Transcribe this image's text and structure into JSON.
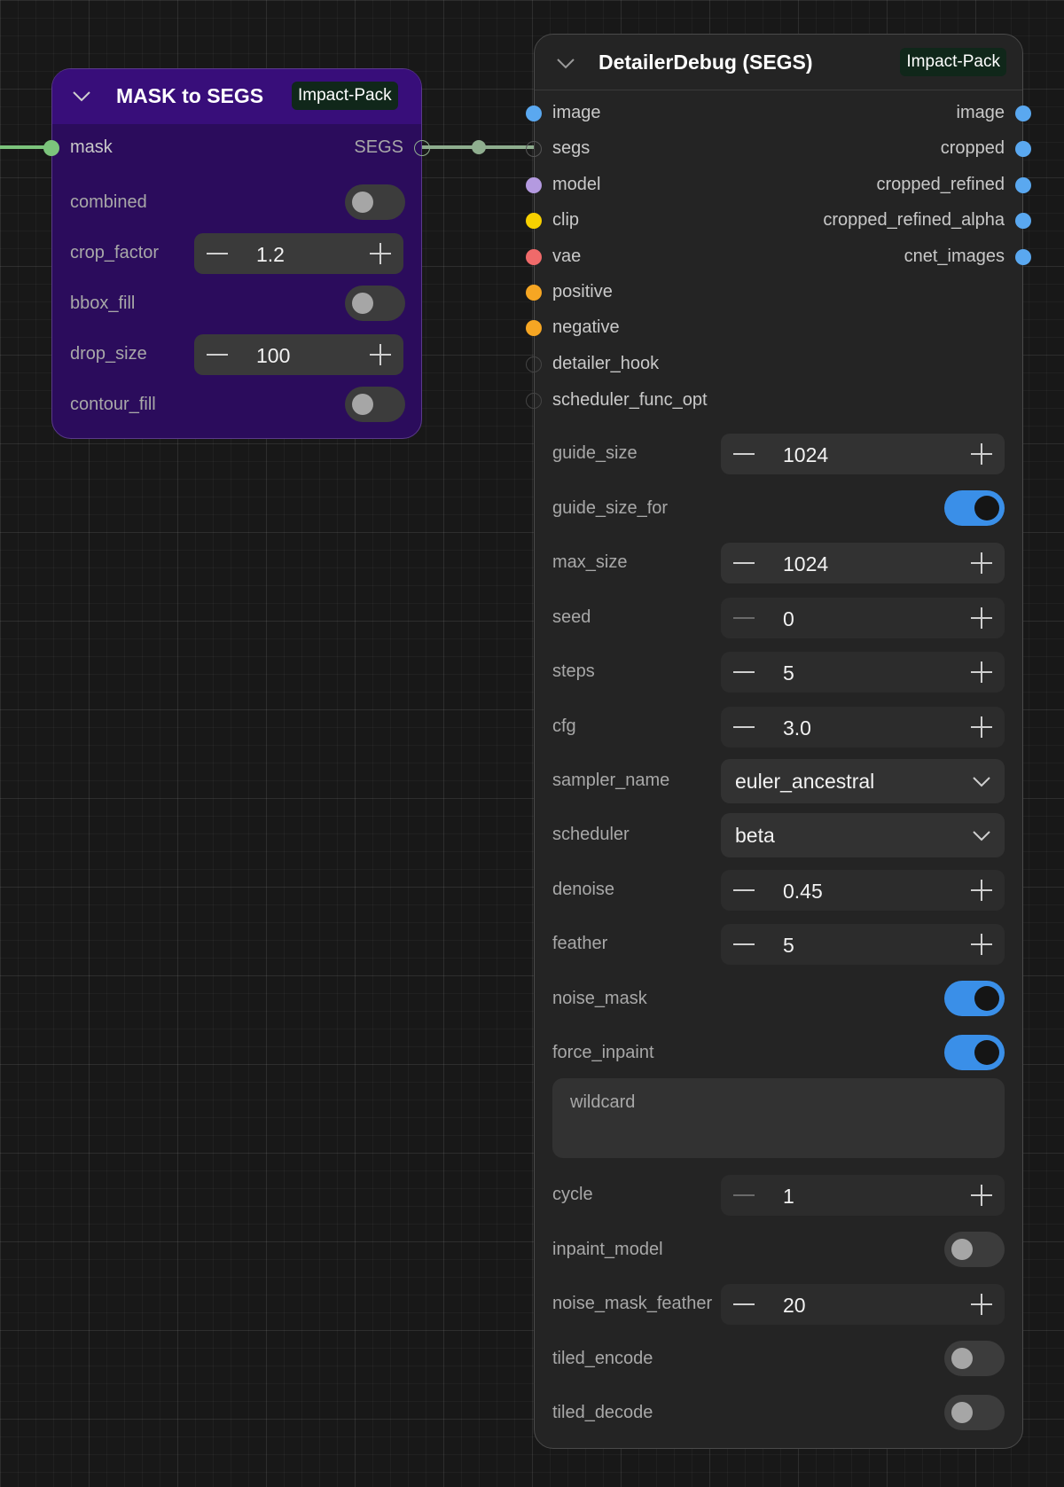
{
  "colors": {
    "canvas_bg": "#181818",
    "mask_node_bg": "#2b0c5c",
    "mask_node_header": "#380e7a",
    "detailer_node_bg": "#242424",
    "badge_bg": "#10271a",
    "toggle_on": "#3a8fe8",
    "link_mask": "#7cc47c",
    "link_segs": "#8fae8f",
    "slot_image": "#5aa8f0",
    "slot_model": "#b49ae0",
    "slot_clip": "#f7d000",
    "slot_vae": "#f06a6a",
    "slot_conditioning": "#f6a623"
  },
  "mask_node": {
    "title": "MASK to SEGS",
    "badge": "Impact-Pack",
    "collapse_icon": "chevron-down-icon",
    "input_label": "mask",
    "output_label": "SEGS",
    "widgets": {
      "combined": {
        "label": "combined",
        "on": false
      },
      "crop_factor": {
        "label": "crop_factor",
        "value": "1.2"
      },
      "bbox_fill": {
        "label": "bbox_fill",
        "on": false
      },
      "drop_size": {
        "label": "drop_size",
        "value": "100"
      },
      "contour_fill": {
        "label": "contour_fill",
        "on": false
      }
    }
  },
  "detailer_node": {
    "title": "DetailerDebug (SEGS)",
    "badge": "Impact-Pack",
    "collapse_icon": "chevron-down-icon",
    "inputs": [
      "image",
      "segs",
      "model",
      "clip",
      "vae",
      "positive",
      "negative",
      "detailer_hook",
      "scheduler_func_opt"
    ],
    "outputs": [
      "image",
      "cropped",
      "cropped_refined",
      "cropped_refined_alpha",
      "cnet_images"
    ],
    "widgets": {
      "guide_size": {
        "label": "guide_size",
        "value": "1024"
      },
      "guide_size_for": {
        "label": "guide_size_for",
        "on": true
      },
      "max_size": {
        "label": "max_size",
        "value": "1024"
      },
      "seed": {
        "label": "seed",
        "value": "0"
      },
      "steps": {
        "label": "steps",
        "value": "5"
      },
      "cfg": {
        "label": "cfg",
        "value": "3.0"
      },
      "sampler_name": {
        "label": "sampler_name",
        "value": "euler_ancestral"
      },
      "scheduler": {
        "label": "scheduler",
        "value": "beta"
      },
      "denoise": {
        "label": "denoise",
        "value": "0.45"
      },
      "feather": {
        "label": "feather",
        "value": "5"
      },
      "noise_mask": {
        "label": "noise_mask",
        "on": true
      },
      "force_inpaint": {
        "label": "force_inpaint",
        "on": true
      },
      "wildcard": {
        "placeholder": "wildcard"
      },
      "cycle": {
        "label": "cycle",
        "value": "1"
      },
      "inpaint_model": {
        "label": "inpaint_model",
        "on": false
      },
      "noise_mask_feather": {
        "label": "noise_mask_feather",
        "value": "20"
      },
      "tiled_encode": {
        "label": "tiled_encode",
        "on": false
      },
      "tiled_decode": {
        "label": "tiled_decode",
        "on": false
      }
    }
  }
}
